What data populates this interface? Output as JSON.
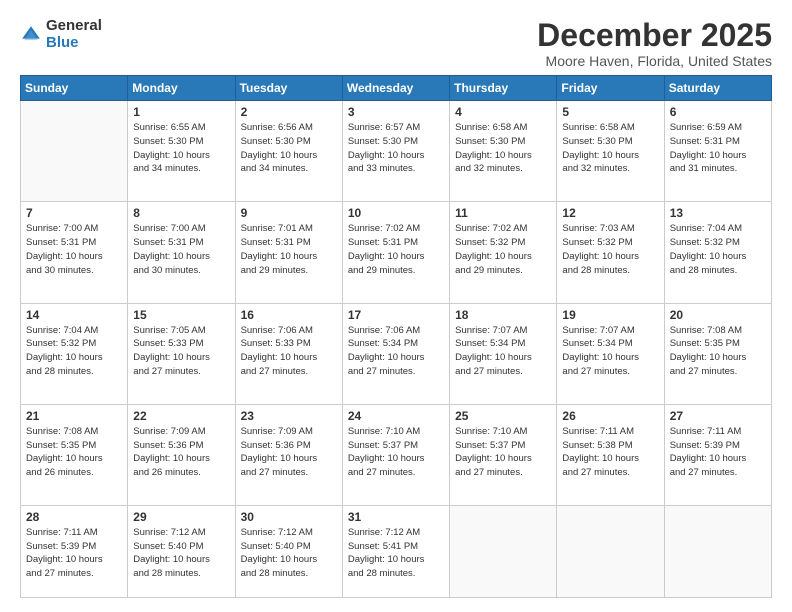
{
  "logo": {
    "general": "General",
    "blue": "Blue"
  },
  "header": {
    "title": "December 2025",
    "subtitle": "Moore Haven, Florida, United States"
  },
  "weekdays": [
    "Sunday",
    "Monday",
    "Tuesday",
    "Wednesday",
    "Thursday",
    "Friday",
    "Saturday"
  ],
  "weeks": [
    [
      {
        "day": "",
        "content": ""
      },
      {
        "day": "1",
        "content": "Sunrise: 6:55 AM\nSunset: 5:30 PM\nDaylight: 10 hours\nand 34 minutes."
      },
      {
        "day": "2",
        "content": "Sunrise: 6:56 AM\nSunset: 5:30 PM\nDaylight: 10 hours\nand 34 minutes."
      },
      {
        "day": "3",
        "content": "Sunrise: 6:57 AM\nSunset: 5:30 PM\nDaylight: 10 hours\nand 33 minutes."
      },
      {
        "day": "4",
        "content": "Sunrise: 6:58 AM\nSunset: 5:30 PM\nDaylight: 10 hours\nand 32 minutes."
      },
      {
        "day": "5",
        "content": "Sunrise: 6:58 AM\nSunset: 5:30 PM\nDaylight: 10 hours\nand 32 minutes."
      },
      {
        "day": "6",
        "content": "Sunrise: 6:59 AM\nSunset: 5:31 PM\nDaylight: 10 hours\nand 31 minutes."
      }
    ],
    [
      {
        "day": "7",
        "content": "Sunrise: 7:00 AM\nSunset: 5:31 PM\nDaylight: 10 hours\nand 30 minutes."
      },
      {
        "day": "8",
        "content": "Sunrise: 7:00 AM\nSunset: 5:31 PM\nDaylight: 10 hours\nand 30 minutes."
      },
      {
        "day": "9",
        "content": "Sunrise: 7:01 AM\nSunset: 5:31 PM\nDaylight: 10 hours\nand 29 minutes."
      },
      {
        "day": "10",
        "content": "Sunrise: 7:02 AM\nSunset: 5:31 PM\nDaylight: 10 hours\nand 29 minutes."
      },
      {
        "day": "11",
        "content": "Sunrise: 7:02 AM\nSunset: 5:32 PM\nDaylight: 10 hours\nand 29 minutes."
      },
      {
        "day": "12",
        "content": "Sunrise: 7:03 AM\nSunset: 5:32 PM\nDaylight: 10 hours\nand 28 minutes."
      },
      {
        "day": "13",
        "content": "Sunrise: 7:04 AM\nSunset: 5:32 PM\nDaylight: 10 hours\nand 28 minutes."
      }
    ],
    [
      {
        "day": "14",
        "content": "Sunrise: 7:04 AM\nSunset: 5:32 PM\nDaylight: 10 hours\nand 28 minutes."
      },
      {
        "day": "15",
        "content": "Sunrise: 7:05 AM\nSunset: 5:33 PM\nDaylight: 10 hours\nand 27 minutes."
      },
      {
        "day": "16",
        "content": "Sunrise: 7:06 AM\nSunset: 5:33 PM\nDaylight: 10 hours\nand 27 minutes."
      },
      {
        "day": "17",
        "content": "Sunrise: 7:06 AM\nSunset: 5:34 PM\nDaylight: 10 hours\nand 27 minutes."
      },
      {
        "day": "18",
        "content": "Sunrise: 7:07 AM\nSunset: 5:34 PM\nDaylight: 10 hours\nand 27 minutes."
      },
      {
        "day": "19",
        "content": "Sunrise: 7:07 AM\nSunset: 5:34 PM\nDaylight: 10 hours\nand 27 minutes."
      },
      {
        "day": "20",
        "content": "Sunrise: 7:08 AM\nSunset: 5:35 PM\nDaylight: 10 hours\nand 27 minutes."
      }
    ],
    [
      {
        "day": "21",
        "content": "Sunrise: 7:08 AM\nSunset: 5:35 PM\nDaylight: 10 hours\nand 26 minutes."
      },
      {
        "day": "22",
        "content": "Sunrise: 7:09 AM\nSunset: 5:36 PM\nDaylight: 10 hours\nand 26 minutes."
      },
      {
        "day": "23",
        "content": "Sunrise: 7:09 AM\nSunset: 5:36 PM\nDaylight: 10 hours\nand 27 minutes."
      },
      {
        "day": "24",
        "content": "Sunrise: 7:10 AM\nSunset: 5:37 PM\nDaylight: 10 hours\nand 27 minutes."
      },
      {
        "day": "25",
        "content": "Sunrise: 7:10 AM\nSunset: 5:37 PM\nDaylight: 10 hours\nand 27 minutes."
      },
      {
        "day": "26",
        "content": "Sunrise: 7:11 AM\nSunset: 5:38 PM\nDaylight: 10 hours\nand 27 minutes."
      },
      {
        "day": "27",
        "content": "Sunrise: 7:11 AM\nSunset: 5:39 PM\nDaylight: 10 hours\nand 27 minutes."
      }
    ],
    [
      {
        "day": "28",
        "content": "Sunrise: 7:11 AM\nSunset: 5:39 PM\nDaylight: 10 hours\nand 27 minutes."
      },
      {
        "day": "29",
        "content": "Sunrise: 7:12 AM\nSunset: 5:40 PM\nDaylight: 10 hours\nand 28 minutes."
      },
      {
        "day": "30",
        "content": "Sunrise: 7:12 AM\nSunset: 5:40 PM\nDaylight: 10 hours\nand 28 minutes."
      },
      {
        "day": "31",
        "content": "Sunrise: 7:12 AM\nSunset: 5:41 PM\nDaylight: 10 hours\nand 28 minutes."
      },
      {
        "day": "",
        "content": ""
      },
      {
        "day": "",
        "content": ""
      },
      {
        "day": "",
        "content": ""
      }
    ]
  ]
}
